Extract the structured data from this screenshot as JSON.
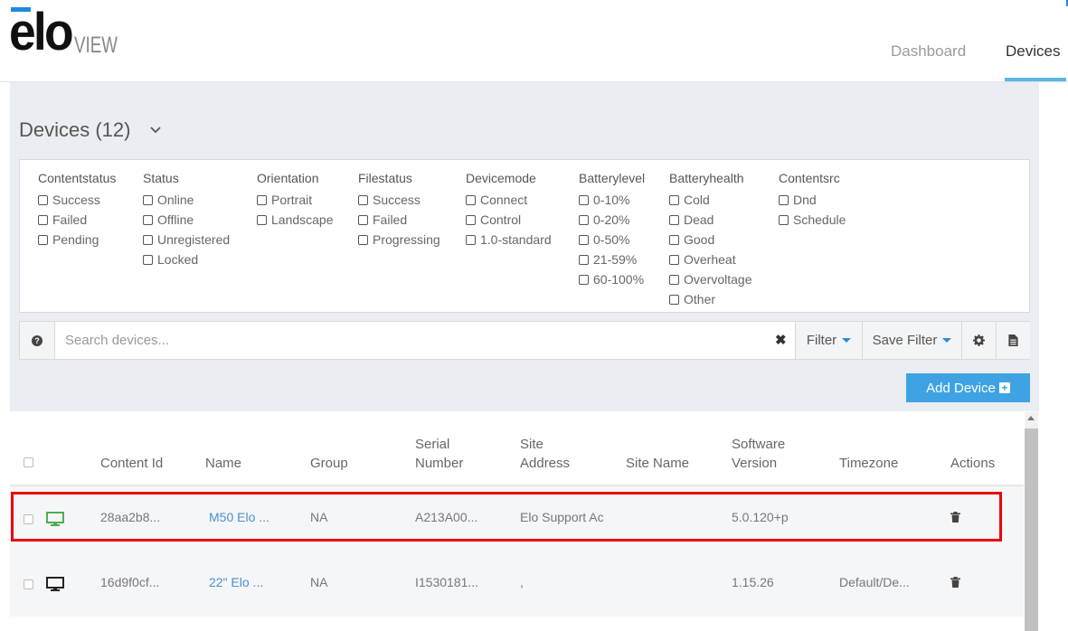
{
  "header": {
    "logo_text": "elo",
    "logo_sub": "VIEW",
    "nav": [
      "Dashboard",
      "Devices"
    ]
  },
  "main": {
    "title": "Devices (12)",
    "filters": [
      {
        "title": "Contentstatus",
        "items": [
          "Success",
          "Failed",
          "Pending"
        ]
      },
      {
        "title": "Status",
        "items": [
          "Online",
          "Offline",
          "Unregistered",
          "Locked"
        ]
      },
      {
        "title": "Orientation",
        "items": [
          "Portrait",
          "Landscape"
        ]
      },
      {
        "title": "Filestatus",
        "items": [
          "Success",
          "Failed",
          "Progressing"
        ]
      },
      {
        "title": "Devicemode",
        "items": [
          "Connect",
          "Control",
          "1.0-standard"
        ]
      },
      {
        "title": "Batterylevel",
        "items": [
          "0-10%",
          "0-20%",
          "0-50%",
          "21-59%",
          "60-100%"
        ]
      },
      {
        "title": "Batteryhealth",
        "items": [
          "Cold",
          "Dead",
          "Good",
          "Overheat",
          "Overvoltage",
          "Other"
        ]
      },
      {
        "title": "Contentsrc",
        "items": [
          "Dnd",
          "Schedule"
        ]
      }
    ],
    "search": {
      "placeholder": "Search devices...",
      "filter_label": "Filter",
      "save_filter_label": "Save Filter"
    },
    "add_device_label": "Add Device"
  },
  "table": {
    "headers": {
      "content_id": "Content Id",
      "name": "Name",
      "group": "Group",
      "serial_1": "Serial",
      "serial_2": "Number",
      "site_1": "Site",
      "site_2": "Address",
      "site_name": "Site Name",
      "sw_1": "Software",
      "sw_2": "Version",
      "timezone": "Timezone",
      "actions": "Actions"
    },
    "rows": [
      {
        "status_color": "#4caf50",
        "content_id": "28aa2b8...",
        "name": "M50 Elo ...",
        "group": "NA",
        "serial": "A213A00...",
        "site_address": "Elo Support Ac",
        "site_name": "",
        "software": "5.0.120+p",
        "timezone": ""
      },
      {
        "status_color": "#222222",
        "content_id": "16d9f0cf...",
        "name": "22\" Elo ...",
        "group": "NA",
        "serial": "I1530181...",
        "site_address": ",",
        "site_name": "",
        "software": "1.15.26",
        "timezone": "Default/De..."
      }
    ]
  }
}
